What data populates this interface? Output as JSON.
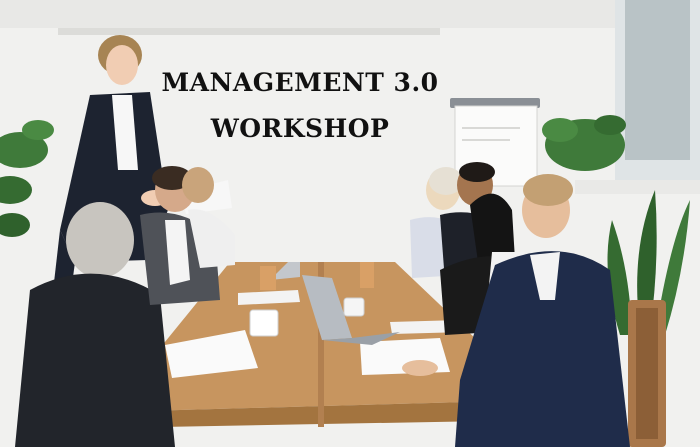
{
  "headline": {
    "line1": "MANAGEMENT 3.0",
    "line2": "WORKSHOP"
  },
  "colors": {
    "wall": "#f1f1ef",
    "table": "#c7955f",
    "suit_dark": "#1d2330",
    "suit_navy": "#1f2c4a",
    "plant": "#3f7a3a",
    "text": "#111111"
  }
}
